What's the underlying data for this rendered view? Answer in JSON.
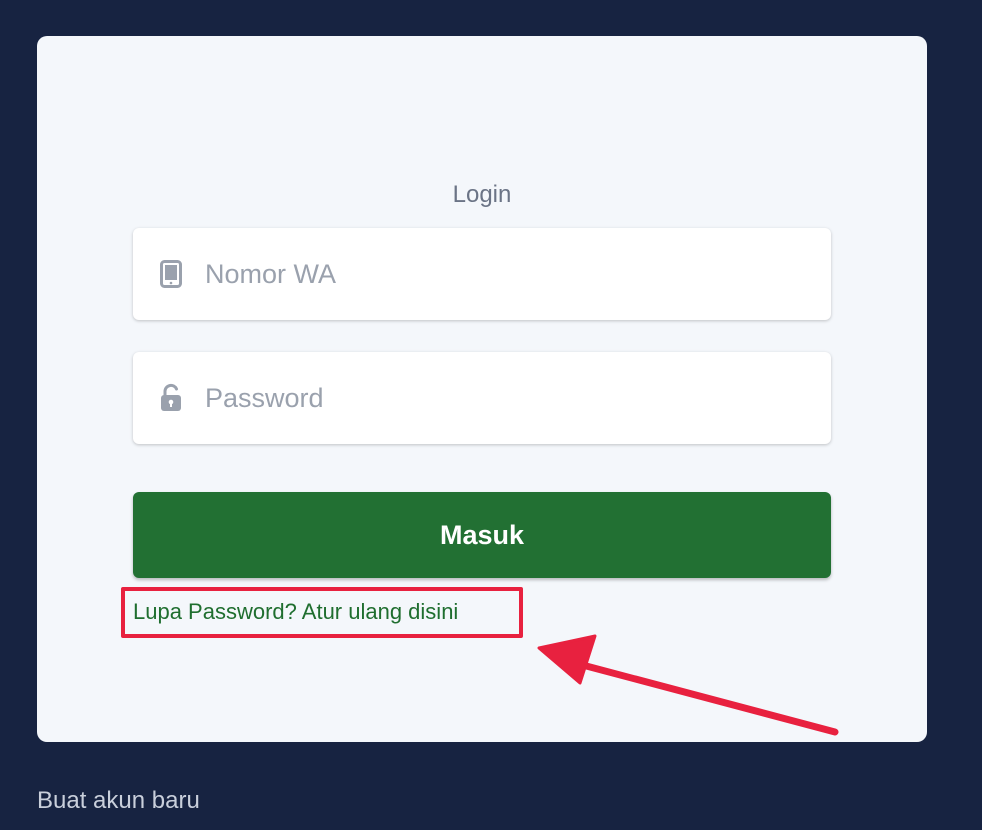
{
  "login": {
    "title": "Login",
    "phone_placeholder": "Nomor WA",
    "password_placeholder": "Password",
    "submit_label": "Masuk",
    "forgot_label": "Lupa Password? Atur ulang disini"
  },
  "footer": {
    "signup_label": "Buat akun baru"
  },
  "icons": {
    "phone": "tablet-icon",
    "password": "unlock-icon"
  },
  "colors": {
    "background": "#172341",
    "card": "#f4f7fb",
    "primary_button": "#227033",
    "link": "#1f6e2f",
    "annotation": "#e8213f"
  }
}
